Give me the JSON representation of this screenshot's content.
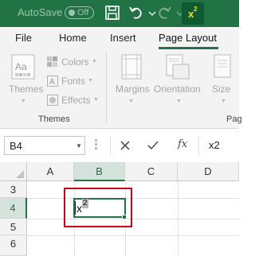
{
  "titlebar": {
    "autosave_label": "AutoSave",
    "autosave_state": "Off",
    "superscript_button": {
      "base": "x",
      "exponent": "2"
    },
    "icons": [
      "save-icon",
      "undo-icon",
      "redo-icon",
      "superscript-icon"
    ]
  },
  "ribbon_tabs": [
    {
      "label": "File"
    },
    {
      "label": "Home"
    },
    {
      "label": "Insert"
    },
    {
      "label": "Page Layout",
      "active": true
    }
  ],
  "ribbon": {
    "themes_button": "Themes",
    "colors": "Colors",
    "fonts": "Fonts",
    "effects": "Effects",
    "themes_group": "Themes",
    "margins": "Margins",
    "orientation": "Orientation",
    "size": "Size",
    "page_setup_group_partial": "Pag"
  },
  "formula_bar": {
    "name_box": "B4",
    "content": "x2",
    "fx_label": "fx"
  },
  "grid": {
    "columns": [
      "A",
      "B",
      "C",
      "D"
    ],
    "selected_column": "B",
    "rows": [
      "3",
      "4",
      "5",
      "6"
    ],
    "selected_row": "4",
    "active_cell": "B4",
    "active_cell_text": {
      "base": "x",
      "superscript": "2"
    }
  },
  "colors": {
    "excel_green": "#217346",
    "highlight_red": "#d0021b",
    "superscript_yellow": "#f5e000"
  }
}
